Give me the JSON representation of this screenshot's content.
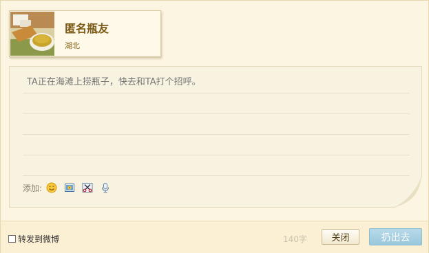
{
  "profile": {
    "name": "匿名瓶友",
    "location": "湖北",
    "avatar_icon": "tea-avatar-icon"
  },
  "compose": {
    "placeholder": "TA正在海滩上捞瓶子，快去和TA打个招呼。",
    "value": ""
  },
  "toolbar": {
    "add_label": "添加:",
    "tools": [
      "emoji-icon",
      "image-icon",
      "scissors-icon",
      "microphone-icon"
    ]
  },
  "footer": {
    "repost_label": "转发到微博",
    "repost_checked": false,
    "char_count": "140字",
    "close_label": "关闭",
    "throw_label": "扔出去"
  },
  "colors": {
    "background": "#fcf5e1",
    "name": "#7a5a14",
    "throw_button": "#9ac7dc"
  }
}
